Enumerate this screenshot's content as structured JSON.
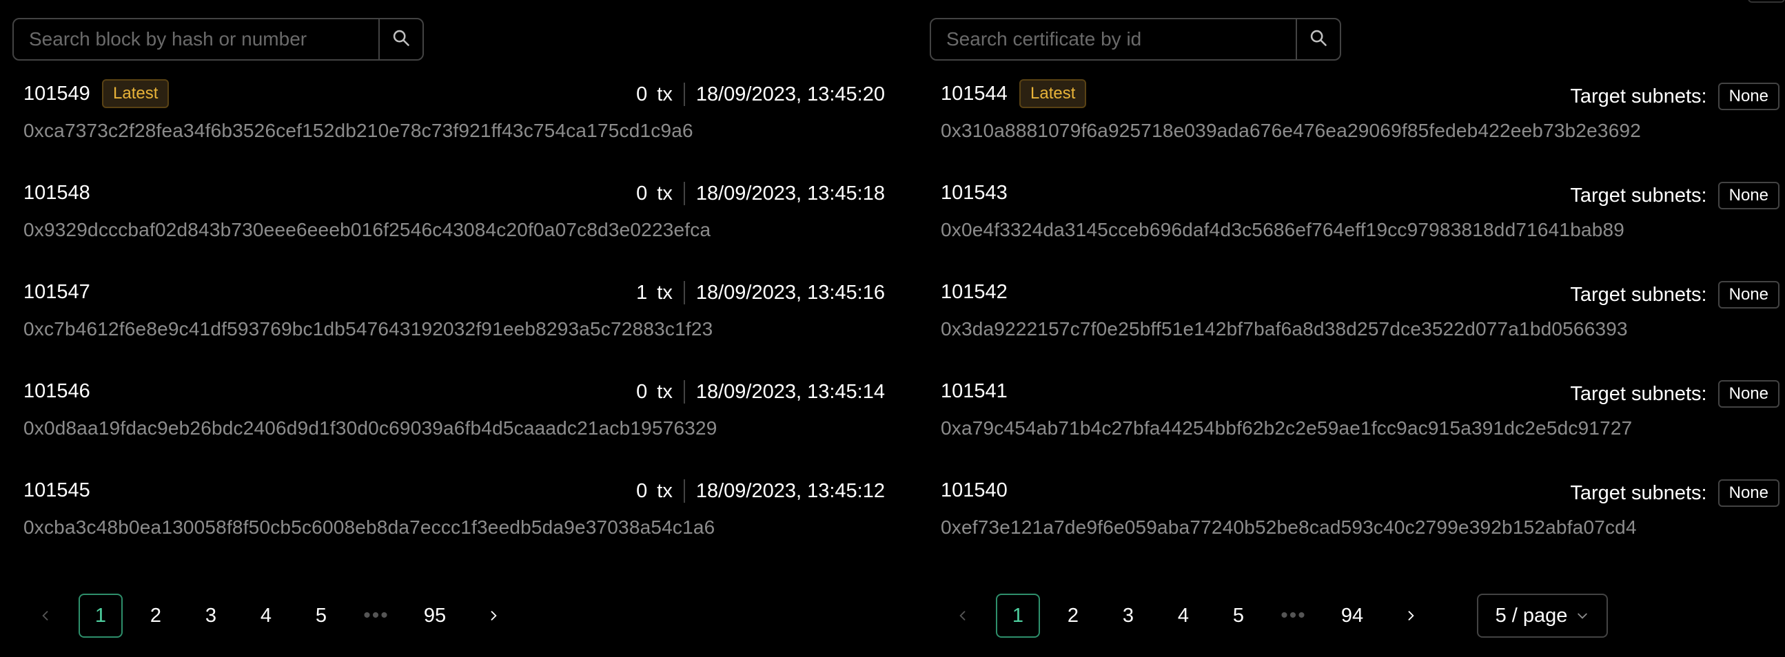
{
  "blocks": {
    "search_placeholder": "Search block by hash or number",
    "latest_label": "Latest",
    "tx_label": "tx",
    "items": [
      {
        "number": "101549",
        "tx": "0",
        "time": "18/09/2023, 13:45:20",
        "hash": "0xca7373c2f28fea34f6b3526cef152db210e78c73f921ff43c754ca175cd1c9a6"
      },
      {
        "number": "101548",
        "tx": "0",
        "time": "18/09/2023, 13:45:18",
        "hash": "0x9329dcccbaf02d843b730eee6eeeb016f2546c43084c20f0a07c8d3e0223efca"
      },
      {
        "number": "101547",
        "tx": "1",
        "time": "18/09/2023, 13:45:16",
        "hash": "0xc7b4612f6e8e9c41df593769bc1db547643192032f91eeb8293a5c72883c1f23"
      },
      {
        "number": "101546",
        "tx": "0",
        "time": "18/09/2023, 13:45:14",
        "hash": "0x0d8aa19fdac9eb26bdc2406d9d1f30d0c69039a6fb4d5caaadc21acb19576329"
      },
      {
        "number": "101545",
        "tx": "0",
        "time": "18/09/2023, 13:45:12",
        "hash": "0xcba3c48b0ea130058f8f50cb5c6008eb8da7eccc1f3eedb5da9e37038a54c1a6"
      }
    ],
    "pagination": {
      "pages": [
        "1",
        "2",
        "3",
        "4",
        "5"
      ],
      "ellipsis": "•••",
      "last": "95",
      "current": "1"
    }
  },
  "certificates": {
    "search_placeholder": "Search certificate by id",
    "latest_label": "Latest",
    "target_label": "Target subnets:",
    "items": [
      {
        "number": "101544",
        "target": "None",
        "hash": "0x310a8881079f6a925718e039ada676e476ea29069f85fedeb422eeb73b2e3692"
      },
      {
        "number": "101543",
        "target": "None",
        "hash": "0x0e4f3324da3145cceb696daf4d3c5686ef764eff19cc97983818dd71641bab89"
      },
      {
        "number": "101542",
        "target": "None",
        "hash": "0x3da9222157c7f0e25bff51e142bf7baf6a8d38d257dce3522d077a1bd0566393"
      },
      {
        "number": "101541",
        "target": "None",
        "hash": "0xa79c454ab71b4c27bfa44254bbf62b2c2e59ae1fcc9ac915a391dc2e5dc91727"
      },
      {
        "number": "101540",
        "target": "None",
        "hash": "0xef73e121a7de9f6e059aba77240b52be8cad593c40c2799e392b152abfa07cd4"
      }
    ],
    "pagination": {
      "pages": [
        "1",
        "2",
        "3",
        "4",
        "5"
      ],
      "ellipsis": "•••",
      "last": "94",
      "current": "1",
      "page_size": "5 / page"
    }
  },
  "colors": {
    "accent": "#4fd1a0",
    "latest_badge": "#e8b339",
    "muted": "#8c8c8c",
    "border": "#434343"
  },
  "icons": [
    "search-icon",
    "chevron-left-icon",
    "chevron-right-icon",
    "chevron-down-icon"
  ]
}
